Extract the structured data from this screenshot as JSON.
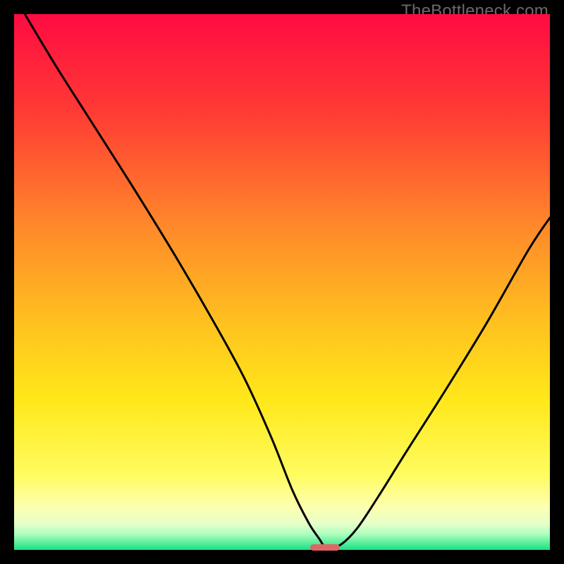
{
  "watermark": "TheBottleneck.com",
  "colors": {
    "frame": "#000000",
    "curve": "#000000",
    "marker": "#e06666",
    "gradient_stops": [
      {
        "pct": 0,
        "color": "#ff0b42"
      },
      {
        "pct": 18,
        "color": "#ff3a34"
      },
      {
        "pct": 40,
        "color": "#ff8a2a"
      },
      {
        "pct": 58,
        "color": "#ffc21f"
      },
      {
        "pct": 72,
        "color": "#ffe81a"
      },
      {
        "pct": 86,
        "color": "#fffc60"
      },
      {
        "pct": 92,
        "color": "#fdffb0"
      },
      {
        "pct": 95,
        "color": "#e8ffc8"
      },
      {
        "pct": 97,
        "color": "#b0ffc0"
      },
      {
        "pct": 98.5,
        "color": "#63f0a0"
      },
      {
        "pct": 100,
        "color": "#18e084"
      }
    ]
  },
  "chart_data": {
    "type": "line",
    "title": "",
    "xlabel": "",
    "ylabel": "",
    "xlim": [
      0,
      100
    ],
    "ylim": [
      0,
      100
    ],
    "legend": false,
    "grid": false,
    "series": [
      {
        "name": "bottleneck-curve",
        "x": [
          2,
          8,
          15,
          22,
          30,
          37,
          43,
          48,
          52,
          55,
          57,
          58,
          59,
          61,
          64,
          68,
          73,
          80,
          88,
          96,
          100
        ],
        "y": [
          100,
          90,
          79,
          68,
          55,
          43,
          32,
          21,
          11,
          5,
          2,
          0.5,
          0.5,
          1,
          4,
          10,
          18,
          29,
          42,
          56,
          62
        ]
      }
    ],
    "marker": {
      "x": 58,
      "y": 0.5,
      "width_pct": 5.5,
      "height_pct": 1.2
    }
  }
}
